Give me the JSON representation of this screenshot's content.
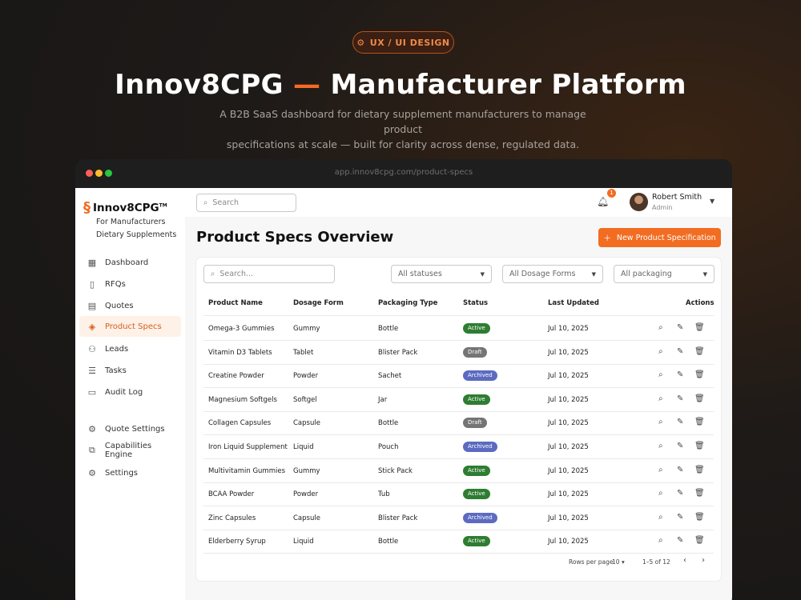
{
  "hero": {
    "badge": "UX / UI DESIGN",
    "title_a": "Innov8CPG",
    "title_dash": "—",
    "title_b": "Manufacturer Platform",
    "subtitle_l1": "A B2B SaaS dashboard for dietary supplement manufacturers to manage product",
    "subtitle_l2": "specifications at scale — built for clarity across dense, regulated data."
  },
  "browser": {
    "url": "app.innov8cpg.com/product-specs"
  },
  "brand": {
    "name": "Innov8CPG",
    "tm": "TM",
    "tagline1": "For Manufacturers",
    "tagline2": "Dietary Supplements"
  },
  "sidebar": {
    "items": [
      {
        "label": "Dashboard",
        "icon": "dashboard-icon"
      },
      {
        "label": "RFQs",
        "icon": "document-icon"
      },
      {
        "label": "Quotes",
        "icon": "receipt-icon"
      },
      {
        "label": "Product Specs",
        "icon": "layers-icon",
        "active": true
      },
      {
        "label": "Leads",
        "icon": "users-icon"
      },
      {
        "label": "Tasks",
        "icon": "checklist-icon"
      },
      {
        "label": "Audit Log",
        "icon": "folder-icon"
      },
      {
        "label": "Quote Settings",
        "icon": "quote-settings-icon"
      },
      {
        "label": "Capabilities Engine",
        "icon": "capabilities-icon"
      },
      {
        "label": "Settings",
        "icon": "gear-icon"
      }
    ]
  },
  "topbar": {
    "search_placeholder": "Search",
    "notifications": "1",
    "user_name": "Robert Smith",
    "user_role": "Admin"
  },
  "page": {
    "title": "Product Specs Overview",
    "new_button": "New Product Specification"
  },
  "filters": {
    "search_placeholder": "Search...",
    "status": "All statuses",
    "dosage": "All Dosage Forms",
    "packaging": "All packaging"
  },
  "table": {
    "headers": [
      "Product Name",
      "Dosage Form",
      "Packaging Type",
      "Status",
      "Last Updated",
      "Actions"
    ],
    "rows": [
      [
        "Omega-3 Gummies",
        "Gummy",
        "Bottle",
        "Active",
        "Jul 10, 2025"
      ],
      [
        "Vitamin D3 Tablets",
        "Tablet",
        "Blister Pack",
        "Draft",
        "Jul 10, 2025"
      ],
      [
        "Creatine Powder",
        "Powder",
        "Sachet",
        "Archived",
        "Jul 10, 2025"
      ],
      [
        "Magnesium Softgels",
        "Softgel",
        "Jar",
        "Active",
        "Jul 10, 2025"
      ],
      [
        "Collagen Capsules",
        "Capsule",
        "Bottle",
        "Draft",
        "Jul 10, 2025"
      ],
      [
        "Iron Liquid Supplement",
        "Liquid",
        "Pouch",
        "Archived",
        "Jul 10, 2025"
      ],
      [
        "Multivitamin Gummies",
        "Gummy",
        "Stick Pack",
        "Active",
        "Jul 10, 2025"
      ],
      [
        "BCAA Powder",
        "Powder",
        "Tub",
        "Active",
        "Jul 10, 2025"
      ],
      [
        "Zinc Capsules",
        "Capsule",
        "Blister Pack",
        "Archived",
        "Jul 10, 2025"
      ],
      [
        "Elderberry Syrup",
        "Liquid",
        "Bottle",
        "Active",
        "Jul 10, 2025"
      ]
    ]
  },
  "status_colors": {
    "Active": "#2e7d32",
    "Draft": "#757575",
    "Archived": "#5c6bc0"
  },
  "pagination": {
    "rows_label": "Rows per page:",
    "rows_value": "10",
    "range": "1–5 of 12"
  }
}
